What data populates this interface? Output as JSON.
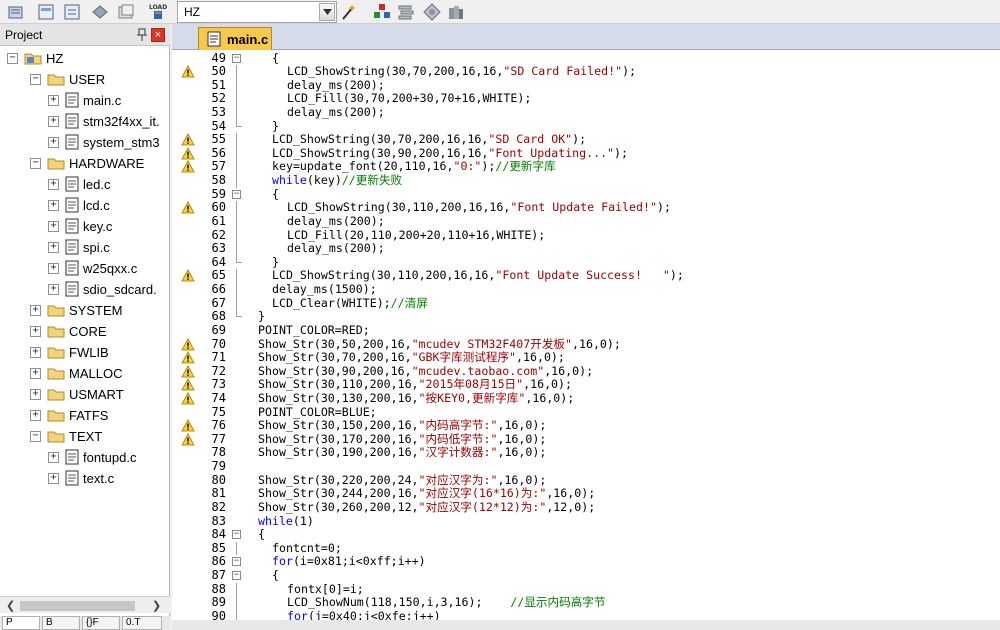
{
  "toolbar": {
    "target_combo_value": "HZ",
    "icons": [
      "pack-icon",
      "options-icon",
      "manage-icon",
      "gem-icon",
      "batch-icon",
      "load-icon",
      "combo-arrow-icon",
      "wand-icon",
      "components-icon",
      "layers-icon",
      "diamond-icon",
      "books-icon"
    ]
  },
  "project": {
    "title": "Project",
    "tree": [
      {
        "label": "HZ",
        "level": 0,
        "kind": "root",
        "expanded": true
      },
      {
        "label": "USER",
        "level": 1,
        "kind": "folder",
        "expanded": true
      },
      {
        "label": "main.c",
        "level": 2,
        "kind": "file"
      },
      {
        "label": "stm32f4xx_it.",
        "level": 2,
        "kind": "file"
      },
      {
        "label": "system_stm3",
        "level": 2,
        "kind": "file"
      },
      {
        "label": "HARDWARE",
        "level": 1,
        "kind": "folder",
        "expanded": true
      },
      {
        "label": "led.c",
        "level": 2,
        "kind": "file"
      },
      {
        "label": "lcd.c",
        "level": 2,
        "kind": "file"
      },
      {
        "label": "key.c",
        "level": 2,
        "kind": "file"
      },
      {
        "label": "spi.c",
        "level": 2,
        "kind": "file"
      },
      {
        "label": "w25qxx.c",
        "level": 2,
        "kind": "file"
      },
      {
        "label": "sdio_sdcard.",
        "level": 2,
        "kind": "file"
      },
      {
        "label": "SYSTEM",
        "level": 1,
        "kind": "folder",
        "expanded": false
      },
      {
        "label": "CORE",
        "level": 1,
        "kind": "folder",
        "expanded": false
      },
      {
        "label": "FWLIB",
        "level": 1,
        "kind": "folder",
        "expanded": false
      },
      {
        "label": "MALLOC",
        "level": 1,
        "kind": "folder",
        "expanded": false
      },
      {
        "label": "USMART",
        "level": 1,
        "kind": "folder",
        "expanded": false
      },
      {
        "label": "FATFS",
        "level": 1,
        "kind": "folder",
        "expanded": false
      },
      {
        "label": "TEXT",
        "level": 1,
        "kind": "folder",
        "expanded": true
      },
      {
        "label": "fontupd.c",
        "level": 2,
        "kind": "file"
      },
      {
        "label": "text.c",
        "level": 2,
        "kind": "file"
      }
    ],
    "bottom_tabs": [
      "P",
      "B",
      "{}F",
      "0.T"
    ]
  },
  "editor": {
    "active_tab": "main.c",
    "lines": [
      {
        "n": "49",
        "warn": false,
        "fold": "open",
        "indent": 4,
        "code": "{"
      },
      {
        "n": "50",
        "warn": true,
        "fold": "line",
        "indent": 5,
        "code": "LCD_ShowString(30,70,200,16,16,\"SD Card Failed!\");"
      },
      {
        "n": "51",
        "warn": false,
        "fold": "line",
        "indent": 5,
        "code": "delay_ms(200);"
      },
      {
        "n": "52",
        "warn": false,
        "fold": "line",
        "indent": 5,
        "code": "LCD_Fill(30,70,200+30,70+16,WHITE);"
      },
      {
        "n": "53",
        "warn": false,
        "fold": "line",
        "indent": 5,
        "code": "delay_ms(200);"
      },
      {
        "n": "54",
        "warn": false,
        "fold": "end",
        "indent": 4,
        "code": "}"
      },
      {
        "n": "55",
        "warn": true,
        "fold": "line",
        "indent": 4,
        "code": "LCD_ShowString(30,70,200,16,16,\"SD Card OK\");"
      },
      {
        "n": "56",
        "warn": true,
        "fold": "line",
        "indent": 4,
        "code": "LCD_ShowString(30,90,200,16,16,\"Font Updating...\");"
      },
      {
        "n": "57",
        "warn": true,
        "fold": "line",
        "indent": 4,
        "code": "key=update_font(20,110,16,\"0:\");//更新字库"
      },
      {
        "n": "58",
        "warn": false,
        "fold": "line",
        "indent": 4,
        "code": "while(key)//更新失败"
      },
      {
        "n": "59",
        "warn": false,
        "fold": "open",
        "indent": 4,
        "code": "{"
      },
      {
        "n": "60",
        "warn": true,
        "fold": "line",
        "indent": 5,
        "code": "LCD_ShowString(30,110,200,16,16,\"Font Update Failed!\");"
      },
      {
        "n": "61",
        "warn": false,
        "fold": "line",
        "indent": 5,
        "code": "delay_ms(200);"
      },
      {
        "n": "62",
        "warn": false,
        "fold": "line",
        "indent": 5,
        "code": "LCD_Fill(20,110,200+20,110+16,WHITE);"
      },
      {
        "n": "63",
        "warn": false,
        "fold": "line",
        "indent": 5,
        "code": "delay_ms(200);"
      },
      {
        "n": "64",
        "warn": false,
        "fold": "end",
        "indent": 4,
        "code": "}"
      },
      {
        "n": "65",
        "warn": true,
        "fold": "line",
        "indent": 4,
        "code": "LCD_ShowString(30,110,200,16,16,\"Font Update Success!   \");"
      },
      {
        "n": "66",
        "warn": false,
        "fold": "line",
        "indent": 4,
        "code": "delay_ms(1500);"
      },
      {
        "n": "67",
        "warn": false,
        "fold": "line",
        "indent": 4,
        "code": "LCD_Clear(WHITE);//清屏"
      },
      {
        "n": "68",
        "warn": false,
        "fold": "end",
        "indent": 3,
        "code": "}"
      },
      {
        "n": "69",
        "warn": false,
        "fold": "none",
        "indent": 3,
        "code": "POINT_COLOR=RED;"
      },
      {
        "n": "70",
        "warn": true,
        "fold": "none",
        "indent": 3,
        "code": "Show_Str(30,50,200,16,\"mcudev STM32F407开发板\",16,0);"
      },
      {
        "n": "71",
        "warn": true,
        "fold": "none",
        "indent": 3,
        "code": "Show_Str(30,70,200,16,\"GBK字库测试程序\",16,0);"
      },
      {
        "n": "72",
        "warn": true,
        "fold": "none",
        "indent": 3,
        "code": "Show_Str(30,90,200,16,\"mcudev.taobao.com\",16,0);"
      },
      {
        "n": "73",
        "warn": true,
        "fold": "none",
        "indent": 3,
        "code": "Show_Str(30,110,200,16,\"2015年08月15日\",16,0);"
      },
      {
        "n": "74",
        "warn": true,
        "fold": "none",
        "indent": 3,
        "code": "Show_Str(30,130,200,16,\"按KEY0,更新字库\",16,0);"
      },
      {
        "n": "75",
        "warn": false,
        "fold": "none",
        "indent": 3,
        "code": "POINT_COLOR=BLUE;"
      },
      {
        "n": "76",
        "warn": true,
        "fold": "none",
        "indent": 3,
        "code": "Show_Str(30,150,200,16,\"内码高字节:\",16,0);"
      },
      {
        "n": "77",
        "warn": true,
        "fold": "none",
        "indent": 3,
        "code": "Show_Str(30,170,200,16,\"内码低字节:\",16,0);"
      },
      {
        "n": "78",
        "warn": false,
        "fold": "none",
        "indent": 3,
        "code": "Show_Str(30,190,200,16,\"汉字计数器:\",16,0);"
      },
      {
        "n": "79",
        "warn": false,
        "fold": "none",
        "indent": 3,
        "code": ""
      },
      {
        "n": "80",
        "warn": false,
        "fold": "none",
        "indent": 3,
        "code": "Show_Str(30,220,200,24,\"对应汉字为:\",16,0);"
      },
      {
        "n": "81",
        "warn": false,
        "fold": "none",
        "indent": 3,
        "code": "Show_Str(30,244,200,16,\"对应汉字(16*16)为:\",16,0);"
      },
      {
        "n": "82",
        "warn": false,
        "fold": "none",
        "indent": 3,
        "code": "Show_Str(30,260,200,12,\"对应汉字(12*12)为:\",12,0);"
      },
      {
        "n": "83",
        "warn": false,
        "fold": "none",
        "indent": 3,
        "code": "while(1)"
      },
      {
        "n": "84",
        "warn": false,
        "fold": "open",
        "indent": 3,
        "code": "{"
      },
      {
        "n": "85",
        "warn": false,
        "fold": "line",
        "indent": 4,
        "code": "fontcnt=0;"
      },
      {
        "n": "86",
        "warn": false,
        "fold": "open",
        "indent": 4,
        "code": "for(i=0x81;i<0xff;i++)"
      },
      {
        "n": "87",
        "warn": false,
        "fold": "open",
        "indent": 4,
        "code": "{"
      },
      {
        "n": "88",
        "warn": false,
        "fold": "line",
        "indent": 5,
        "code": "fontx[0]=i;"
      },
      {
        "n": "89",
        "warn": false,
        "fold": "line",
        "indent": 5,
        "code": "LCD_ShowNum(118,150,i,3,16);    //显示内码高字节"
      },
      {
        "n": "90",
        "warn": false,
        "fold": "line",
        "indent": 5,
        "code": "for(j=0x40;j<0xfe;j++)"
      }
    ]
  }
}
